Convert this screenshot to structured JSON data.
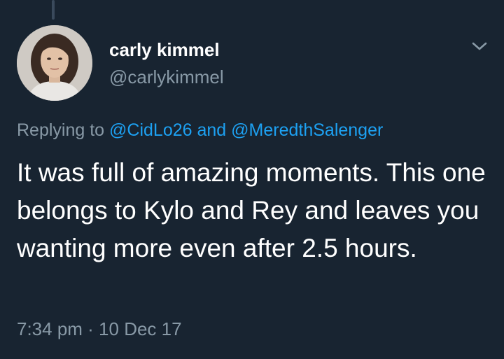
{
  "tweet": {
    "author": {
      "display_name": "carly kimmel",
      "handle": "@carlykimmel",
      "avatar_icon": "profile-photo"
    },
    "reply_context": {
      "prefix": "Replying to ",
      "mentions": [
        "@CidLo26",
        "@MeredthSalenger"
      ],
      "joiner": " and "
    },
    "text": "It was full of amazing moments. This one belongs to Kylo and Rey and leaves you wanting more even after 2.5 hours.",
    "timestamp": "7:34 pm · 10 Dec 17",
    "menu_icon": "chevron-down-icon"
  },
  "colors": {
    "background": "#182431",
    "primary_text": "#ffffff",
    "secondary_text": "#8899a6",
    "link": "#1da1f2"
  }
}
